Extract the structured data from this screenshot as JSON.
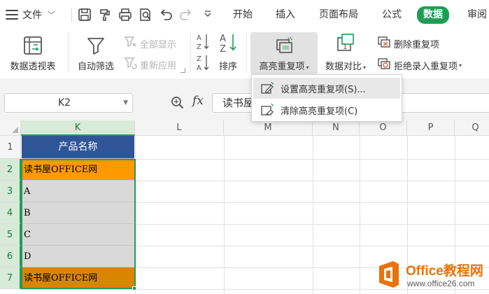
{
  "menubar": {
    "file_label": "文件",
    "tabs": [
      {
        "label": "开始"
      },
      {
        "label": "插入"
      },
      {
        "label": "页面布局"
      },
      {
        "label": "公式"
      },
      {
        "label": "数据",
        "active": true
      },
      {
        "label": "审阅"
      }
    ],
    "quick_access_icons": [
      "save-icon",
      "format-painter-icon",
      "print-icon",
      "print-preview-icon",
      "undo-icon",
      "redo-icon",
      "customize-dropdown-icon"
    ]
  },
  "ribbon": {
    "pivot_table": "数据透视表",
    "auto_filter": "自动筛选",
    "show_all": "全部显示",
    "reapply": "重新应用",
    "sort": "排序",
    "highlight_duplicates": "高亮重复项",
    "data_compare": "数据对比",
    "remove_duplicates": "删除重复项",
    "reject_duplicates": "拒绝录入重复项"
  },
  "dropdown": {
    "items": [
      {
        "label": "设置高亮重复项(S)...",
        "icon": "highlight-settings-icon"
      },
      {
        "label": "清除高亮重复项(C)",
        "icon": "clear-highlight-icon"
      }
    ]
  },
  "formula_bar": {
    "name_box": "K2",
    "fx": "fx",
    "content": "读书屋"
  },
  "grid": {
    "columns": [
      "K",
      "L",
      "M",
      "N",
      "O",
      "P",
      "Q"
    ],
    "rows": [
      "1",
      "2",
      "3",
      "4",
      "5",
      "6",
      "7"
    ],
    "selected_column": "K",
    "cells": [
      {
        "row": "1",
        "value": "产品名称",
        "fill": "#2f5597"
      },
      {
        "row": "2",
        "value": "读书屋OFFICE网",
        "fill": "#ff9900"
      },
      {
        "row": "3",
        "value": "A",
        "fill": "#d9d9d9"
      },
      {
        "row": "4",
        "value": "B",
        "fill": "#d9d9d9"
      },
      {
        "row": "5",
        "value": "C",
        "fill": "#d9d9d9"
      },
      {
        "row": "6",
        "value": "D",
        "fill": "#d9d9d9"
      },
      {
        "row": "7",
        "value": "读书屋OFFICE网",
        "fill": "#d88500"
      }
    ]
  },
  "watermark": {
    "title": "Office教程网",
    "url": "www.office26.com"
  },
  "colors": {
    "accent": "#1f9d55",
    "header_fill": "#2f5597",
    "duplicate_highlight": "#ff9900"
  }
}
